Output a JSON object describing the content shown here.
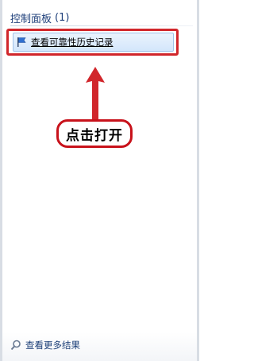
{
  "group": {
    "title": "控制面板",
    "count": "(1)"
  },
  "results": [
    {
      "label": "查看可靠性历史记录",
      "icon": "flag-icon"
    }
  ],
  "annotation": {
    "callout_text": "点击打开",
    "color": "#d1262b"
  },
  "footer": {
    "more_results_label": "查看更多结果",
    "icon": "search-icon"
  }
}
